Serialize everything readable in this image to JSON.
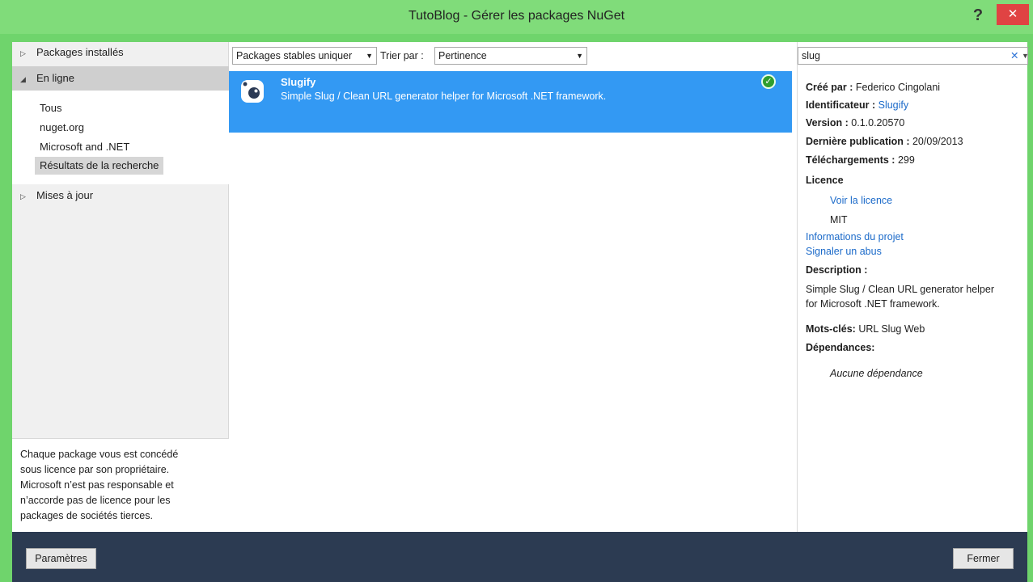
{
  "window": {
    "title": "TutoBlog - Gérer les packages NuGet",
    "help_label": "?",
    "close_label": "✕"
  },
  "sidebar": {
    "installed": "Packages installés",
    "online": "En ligne",
    "online_items": [
      "Tous",
      "nuget.org",
      "Microsoft and .NET",
      "Résultats de la recherche"
    ],
    "updates": "Mises à jour",
    "disclaimer": [
      "Chaque package vous est concédé",
      "sous licence par son propriétaire.",
      "Microsoft n’est pas responsable et",
      "n’accorde pas de licence pour les",
      "packages de sociétés tierces."
    ]
  },
  "toolbar": {
    "filter_value": "Packages stables uniquer",
    "sort_label": "Trier par :",
    "sort_value": "Pertinence"
  },
  "search": {
    "value": "slug"
  },
  "results": [
    {
      "name": "Slugify",
      "description": "Simple Slug / Clean URL generator helper for Microsoft .NET framework.",
      "installed": true
    }
  ],
  "details": {
    "created_by_label": "Créé par :",
    "created_by": "Federico Cingolani",
    "id_label": "Identificateur :",
    "id": "Slugify",
    "version_label": "Version :",
    "version": "0.1.0.20570",
    "published_label": "Dernière publication :",
    "published": "20/09/2013",
    "downloads_label": "Téléchargements :",
    "downloads": "299",
    "license_label": "Licence",
    "view_license": "Voir la licence",
    "license": "MIT",
    "project_info": "Informations du projet",
    "report_abuse": "Signaler un abus",
    "description_label": "Description :",
    "description_lines": [
      "Simple Slug / Clean URL generator helper",
      "for Microsoft .NET framework."
    ],
    "tags_label": "Mots-clés:",
    "tags": "URL Slug Web",
    "dependencies_label": "Dépendances:",
    "dependencies": "Aucune dépendance"
  },
  "footer": {
    "settings_label": "Paramètres",
    "close_label": "Fermer"
  }
}
